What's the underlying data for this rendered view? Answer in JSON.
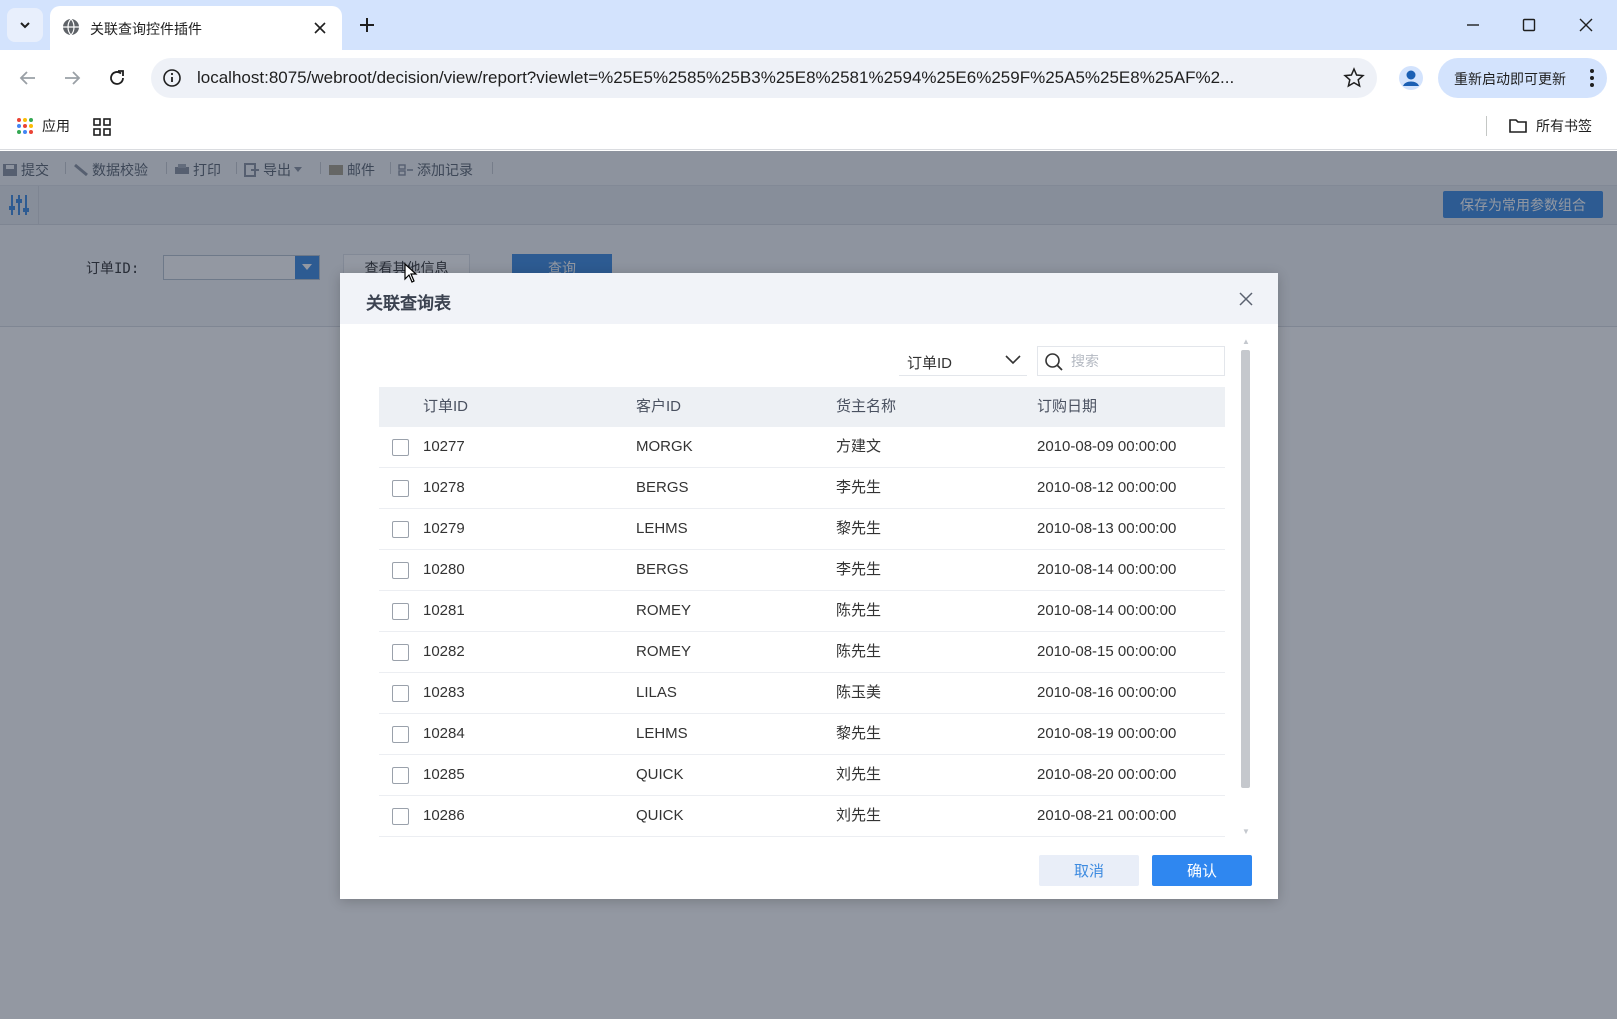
{
  "browser": {
    "tab_title": "关联查询控件插件",
    "url": "localhost:8075/webroot/decision/view/report?viewlet=%25E5%2585%25B3%25E8%2581%2594%25E6%259F%25A5%25E8%25AF%2...",
    "update_label": "重新启动即可更新",
    "bookmarks": {
      "apps_label": "应用",
      "all_bookmarks_label": "所有书签"
    }
  },
  "toolbar": {
    "submit": "提交",
    "validate": "数据校验",
    "print": "打印",
    "export": "导出",
    "mail": "邮件",
    "add_record": "添加记录"
  },
  "params": {
    "save_combo_label": "保存为常用参数组合",
    "order_id_label": "订单ID:",
    "other_info_label": "查看其他信息",
    "query_label": "查询"
  },
  "dialog": {
    "title": "关联查询表",
    "field_select_value": "订单ID",
    "search_placeholder": "搜索",
    "columns": [
      "订单ID",
      "客户ID",
      "货主名称",
      "订购日期"
    ],
    "rows": [
      [
        "10277",
        "MORGK",
        "方建文",
        "2010-08-09 00:00:00"
      ],
      [
        "10278",
        "BERGS",
        "李先生",
        "2010-08-12 00:00:00"
      ],
      [
        "10279",
        "LEHMS",
        "黎先生",
        "2010-08-13 00:00:00"
      ],
      [
        "10280",
        "BERGS",
        "李先生",
        "2010-08-14 00:00:00"
      ],
      [
        "10281",
        "ROMEY",
        "陈先生",
        "2010-08-14 00:00:00"
      ],
      [
        "10282",
        "ROMEY",
        "陈先生",
        "2010-08-15 00:00:00"
      ],
      [
        "10283",
        "LILAS",
        "陈玉美",
        "2010-08-16 00:00:00"
      ],
      [
        "10284",
        "LEHMS",
        "黎先生",
        "2010-08-19 00:00:00"
      ],
      [
        "10285",
        "QUICK",
        "刘先生",
        "2010-08-20 00:00:00"
      ],
      [
        "10286",
        "QUICK",
        "刘先生",
        "2010-08-21 00:00:00"
      ]
    ],
    "cancel_label": "取消",
    "confirm_label": "确认"
  },
  "colors": {
    "accent": "#2f87f0",
    "tab_strip": "#d3e3fd",
    "overlay": "#1e283c"
  }
}
